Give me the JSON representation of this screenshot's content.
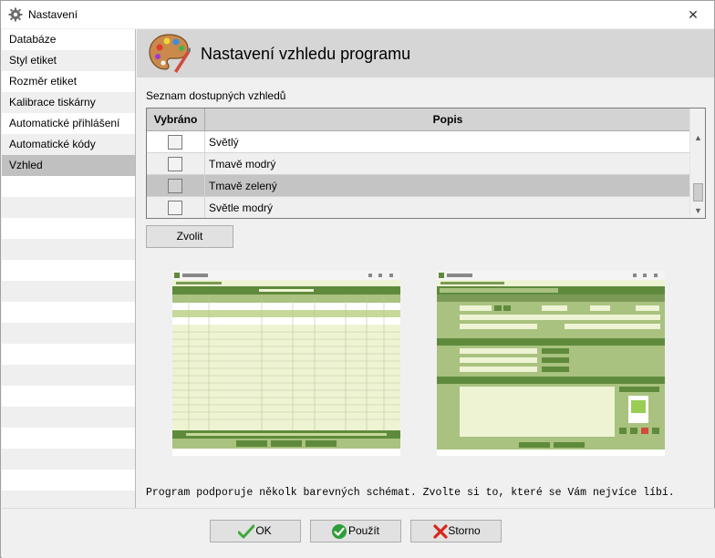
{
  "window": {
    "title": "Nastavení",
    "close_glyph": "✕"
  },
  "sidebar": {
    "items": [
      {
        "label": "Databáze"
      },
      {
        "label": "Styl etiket"
      },
      {
        "label": "Rozměr etiket"
      },
      {
        "label": "Kalibrace tiskárny"
      },
      {
        "label": "Automatické přihlášení"
      },
      {
        "label": "Automatické kódy"
      },
      {
        "label": "Vzhled"
      }
    ],
    "selected_index": 6
  },
  "header": {
    "title": "Nastavení vzhledu programu",
    "icon": "palette-icon"
  },
  "list": {
    "label": "Seznam dostupných vzhledů",
    "columns": [
      "Vybráno",
      "Popis"
    ],
    "rows": [
      {
        "checked": false,
        "label": "Světlý"
      },
      {
        "checked": false,
        "label": "Tmavě modrý"
      },
      {
        "checked": false,
        "label": "Tmavě zelený"
      },
      {
        "checked": false,
        "label": "Světle modrý"
      }
    ],
    "selected_row": 2
  },
  "buttons": {
    "choose": "Zvolit",
    "ok": "OK",
    "apply": "Použít",
    "cancel": "Storno"
  },
  "footer_text": "Program podporuje několk barevných schémat. Zvolte si to, které se Vám nejvíce líbí.",
  "colors": {
    "preview_green_dark": "#5f8a3c",
    "preview_green_mid": "#a9c27f",
    "preview_green_light": "#eef3d4",
    "ok_green": "#3da83a",
    "apply_green": "#2e9d3a",
    "cancel_red": "#d9261c"
  }
}
